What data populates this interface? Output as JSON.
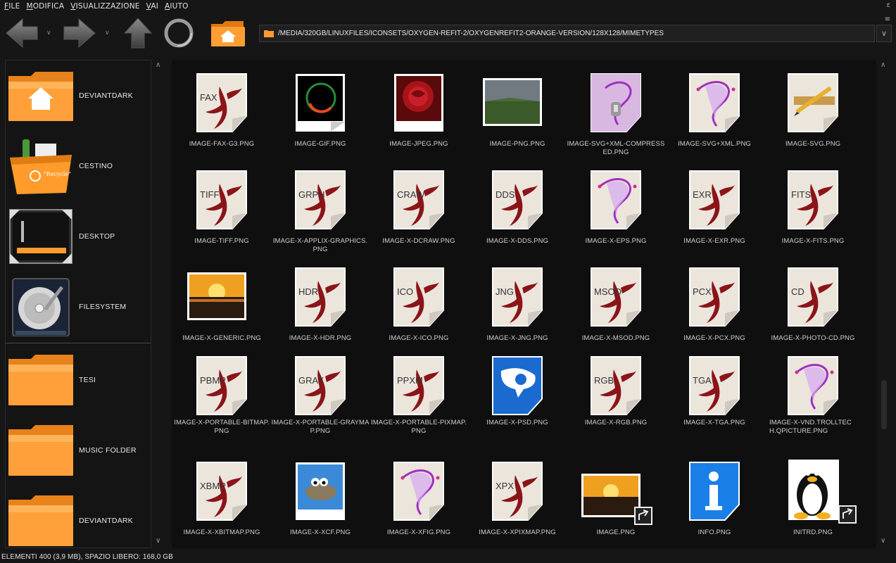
{
  "menubar": {
    "items": [
      "FILE",
      "MODIFICA",
      "VISUALIZZAZIONE",
      "VAI",
      "AIUTO"
    ]
  },
  "window": {
    "controls": [
      "ε",
      "≡"
    ]
  },
  "toolbar": {
    "back": "back",
    "forward": "forward",
    "up": "up",
    "reload": "reload",
    "home": "home"
  },
  "location": {
    "path": "/MEDIA/320GB/LINUXFILES/ICONSETS/OXYGEN-REFIT-2/OXYGENREFIT2-ORANGE-VERSION/128X128/MIMETYPES",
    "dropdown": "∨"
  },
  "places": {
    "items": [
      {
        "label": "DEVIANTDARK",
        "icon": "home-folder-icon"
      },
      {
        "label": "CESTINO",
        "icon": "trash-icon"
      },
      {
        "label": "DESKTOP",
        "icon": "desktop-icon"
      },
      {
        "label": "FILESYSTEM",
        "icon": "harddisk-icon"
      },
      {
        "label": "TESI",
        "icon": "folder-icon"
      },
      {
        "label": "MUSIC FOLDER",
        "icon": "folder-icon"
      },
      {
        "label": "DEVIANTDARK",
        "icon": "folder-icon"
      }
    ]
  },
  "scroll": {
    "up": "∧",
    "down": "∨"
  },
  "files": {
    "rows": [
      [
        {
          "name": "IMAGE-FAX-G3.PNG",
          "kind": "bird",
          "tag": "FAX"
        },
        {
          "name": "IMAGE-GIF.PNG",
          "kind": "gif"
        },
        {
          "name": "IMAGE-JPEG.PNG",
          "kind": "rose"
        },
        {
          "name": "IMAGE-PNG.PNG",
          "kind": "landscape"
        },
        {
          "name": "IMAGE-SVG+XML-COMPRESSED.PNG",
          "kind": "svgz"
        },
        {
          "name": "IMAGE-SVG+XML.PNG",
          "kind": "svg"
        },
        {
          "name": "IMAGE-SVG.PNG",
          "kind": "pencil"
        }
      ],
      [
        {
          "name": "IMAGE-TIFF.PNG",
          "kind": "bird",
          "tag": "TIFF"
        },
        {
          "name": "IMAGE-X-APPLIX-GRAPHICS.PNG",
          "kind": "bird",
          "tag": "GRPH"
        },
        {
          "name": "IMAGE-X-DCRAW.PNG",
          "kind": "bird",
          "tag": "CRAW"
        },
        {
          "name": "IMAGE-X-DDS.PNG",
          "kind": "bird",
          "tag": "DDS"
        },
        {
          "name": "IMAGE-X-EPS.PNG",
          "kind": "svg"
        },
        {
          "name": "IMAGE-X-EXR.PNG",
          "kind": "bird",
          "tag": "EXR"
        },
        {
          "name": "IMAGE-X-FITS.PNG",
          "kind": "bird",
          "tag": "FITS"
        }
      ],
      [
        {
          "name": "IMAGE-X-GENERIC.PNG",
          "kind": "sunset"
        },
        {
          "name": "IMAGE-X-HDR.PNG",
          "kind": "bird",
          "tag": "HDR"
        },
        {
          "name": "IMAGE-X-ICO.PNG",
          "kind": "bird",
          "tag": "ICO"
        },
        {
          "name": "IMAGE-X-JNG.PNG",
          "kind": "bird",
          "tag": "JNG"
        },
        {
          "name": "IMAGE-X-MSOD.PNG",
          "kind": "bird",
          "tag": "MSOD"
        },
        {
          "name": "IMAGE-X-PCX.PNG",
          "kind": "bird",
          "tag": "PCX"
        },
        {
          "name": "IMAGE-X-PHOTO-CD.PNG",
          "kind": "bird",
          "tag": "CD"
        }
      ],
      [
        {
          "name": "IMAGE-X-PORTABLE-BITMAP.PNG",
          "kind": "bird",
          "tag": "PBMP"
        },
        {
          "name": "IMAGE-X-PORTABLE-GRAYMAP.PNG",
          "kind": "bird",
          "tag": "GRAY"
        },
        {
          "name": "IMAGE-X-PORTABLE-PIXMAP.PNG",
          "kind": "bird",
          "tag": "PPXM"
        },
        {
          "name": "IMAGE-X-PSD.PNG",
          "kind": "psd"
        },
        {
          "name": "IMAGE-X-RGB.PNG",
          "kind": "bird",
          "tag": "RGB"
        },
        {
          "name": "IMAGE-X-TGA.PNG",
          "kind": "bird",
          "tag": "TGA"
        },
        {
          "name": "IMAGE-X-VND.TROLLTECH.QPICTURE.PNG",
          "kind": "svg"
        }
      ],
      [
        {
          "name": "IMAGE-X-XBITMAP.PNG",
          "kind": "bird",
          "tag": "XBMP"
        },
        {
          "name": "IMAGE-X-XCF.PNG",
          "kind": "gimp"
        },
        {
          "name": "IMAGE-X-XFIG.PNG",
          "kind": "svg"
        },
        {
          "name": "IMAGE-X-XPIXMAP.PNG",
          "kind": "bird",
          "tag": "XPX"
        },
        {
          "name": "IMAGE.PNG",
          "kind": "sunset-link"
        },
        {
          "name": "INFO.PNG",
          "kind": "info"
        },
        {
          "name": "INITRD.PNG",
          "kind": "tux"
        }
      ]
    ]
  },
  "status": {
    "text": "ELEMENTI 400 (3,9 MB), SPAZIO LIBERO: 168,0 GB"
  },
  "colors": {
    "folder": "#ff9a2e",
    "bird": "#8b1418",
    "page": "#ebe5dc",
    "svg_purple": "#a030c0",
    "background": "#161616"
  }
}
